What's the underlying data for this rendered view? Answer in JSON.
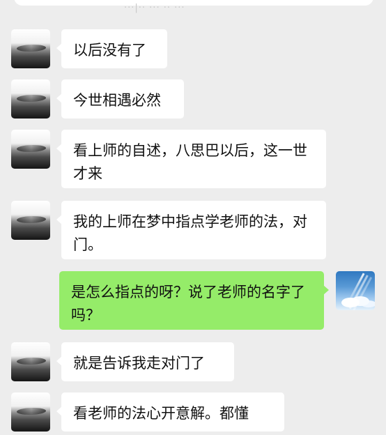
{
  "header": {
    "partial_text": "···|·· ··· ·· ···"
  },
  "messages": [
    {
      "side": "left",
      "text": "以后没有了"
    },
    {
      "side": "left",
      "text": "今世相遇必然"
    },
    {
      "side": "left",
      "text": "看上师的自述，八思巴以后，这一世才来"
    },
    {
      "side": "left",
      "text": "我的上师在梦中指点学老师的法，对门。"
    },
    {
      "side": "right",
      "text": "是怎么指点的呀？说了老师的名字了吗？"
    },
    {
      "side": "left",
      "text": "就是告诉我走对门了"
    },
    {
      "side": "left",
      "text": "看老师的法心开意解。都懂"
    }
  ],
  "colors": {
    "background": "#ededed",
    "incoming_bubble": "#ffffff",
    "outgoing_bubble": "#95ec69"
  }
}
